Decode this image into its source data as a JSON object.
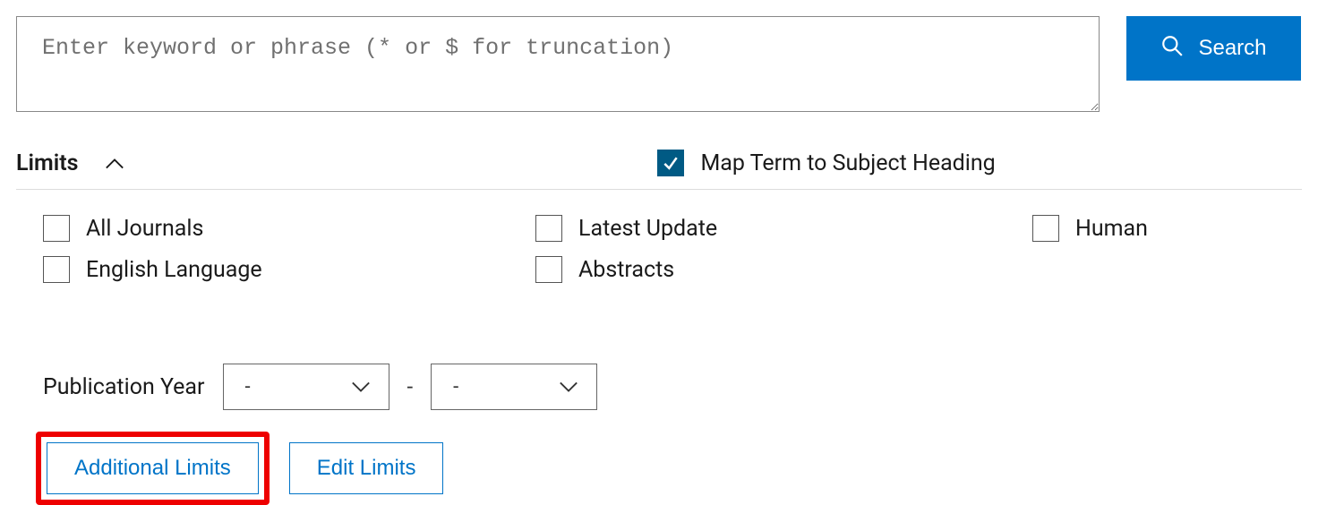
{
  "search": {
    "placeholder": "Enter keyword or phrase (* or $ for truncation)",
    "value": "",
    "button_label": "Search"
  },
  "limits": {
    "title": "Limits",
    "map_term_label": "Map Term to Subject Heading",
    "map_term_checked": true,
    "checkboxes": {
      "all_journals": "All Journals",
      "english_language": "English Language",
      "latest_update": "Latest Update",
      "abstracts": "Abstracts",
      "human": "Human"
    },
    "publication_year": {
      "label": "Publication Year",
      "from": "-",
      "to": "-",
      "separator": "-"
    },
    "actions": {
      "additional_limits": "Additional Limits",
      "edit_limits": "Edit Limits"
    }
  }
}
